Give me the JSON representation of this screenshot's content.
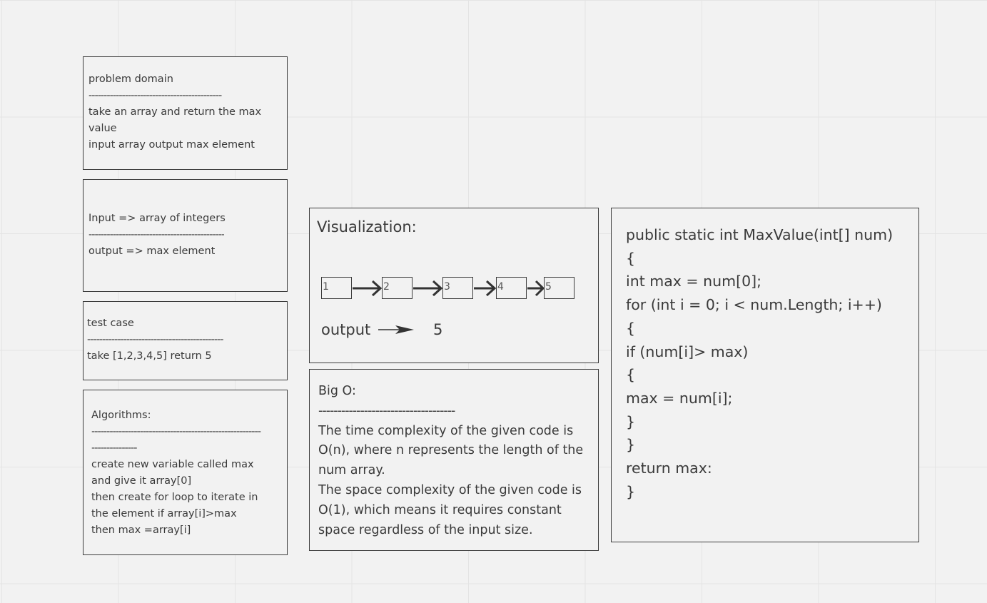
{
  "problem_domain": {
    "title": "problem domain",
    "divider": "--------------------------------------------",
    "body_1": "take an array and return the max value",
    "body_2": "input array output max element"
  },
  "io_card": {
    "input": "Input => array of integers",
    "divider": "---------------------------------------------",
    "output": "output => max element"
  },
  "test_case": {
    "title": "test case",
    "divider": "---------------------------------------------",
    "body": "take [1,2,3,4,5] return 5"
  },
  "algorithms": {
    "title": "Algorithms:",
    "divider_1": "--------------------------------------------------------",
    "divider_2": "---------------",
    "lines": [
      "create new variable called max",
      "and give it array[0]",
      "then create for loop to iterate in",
      "the element if array[i]>max",
      "then max =array[i]"
    ]
  },
  "visualization": {
    "title": "Visualization:",
    "nodes": [
      "1",
      "2",
      "3",
      "4",
      "5"
    ],
    "output_label": "output",
    "output_value": "5"
  },
  "big_o": {
    "title": "Big O:",
    "divider": "------------------------------------",
    "time_complexity": "The time complexity of the given code is O(n), where n represents the length of the num array.",
    "space_complexity": "The space complexity of the given code is O(1), which means it requires constant space regardless of the input size."
  },
  "code": {
    "lines": [
      "public static int MaxValue(int[] num)",
      "{",
      "int max = num[0];",
      "for (int i = 0; i < num.Length; i++)",
      "{",
      "if (num[i]> max)",
      "{",
      "max = num[i];",
      "}",
      "}",
      "return max:",
      "}"
    ]
  }
}
